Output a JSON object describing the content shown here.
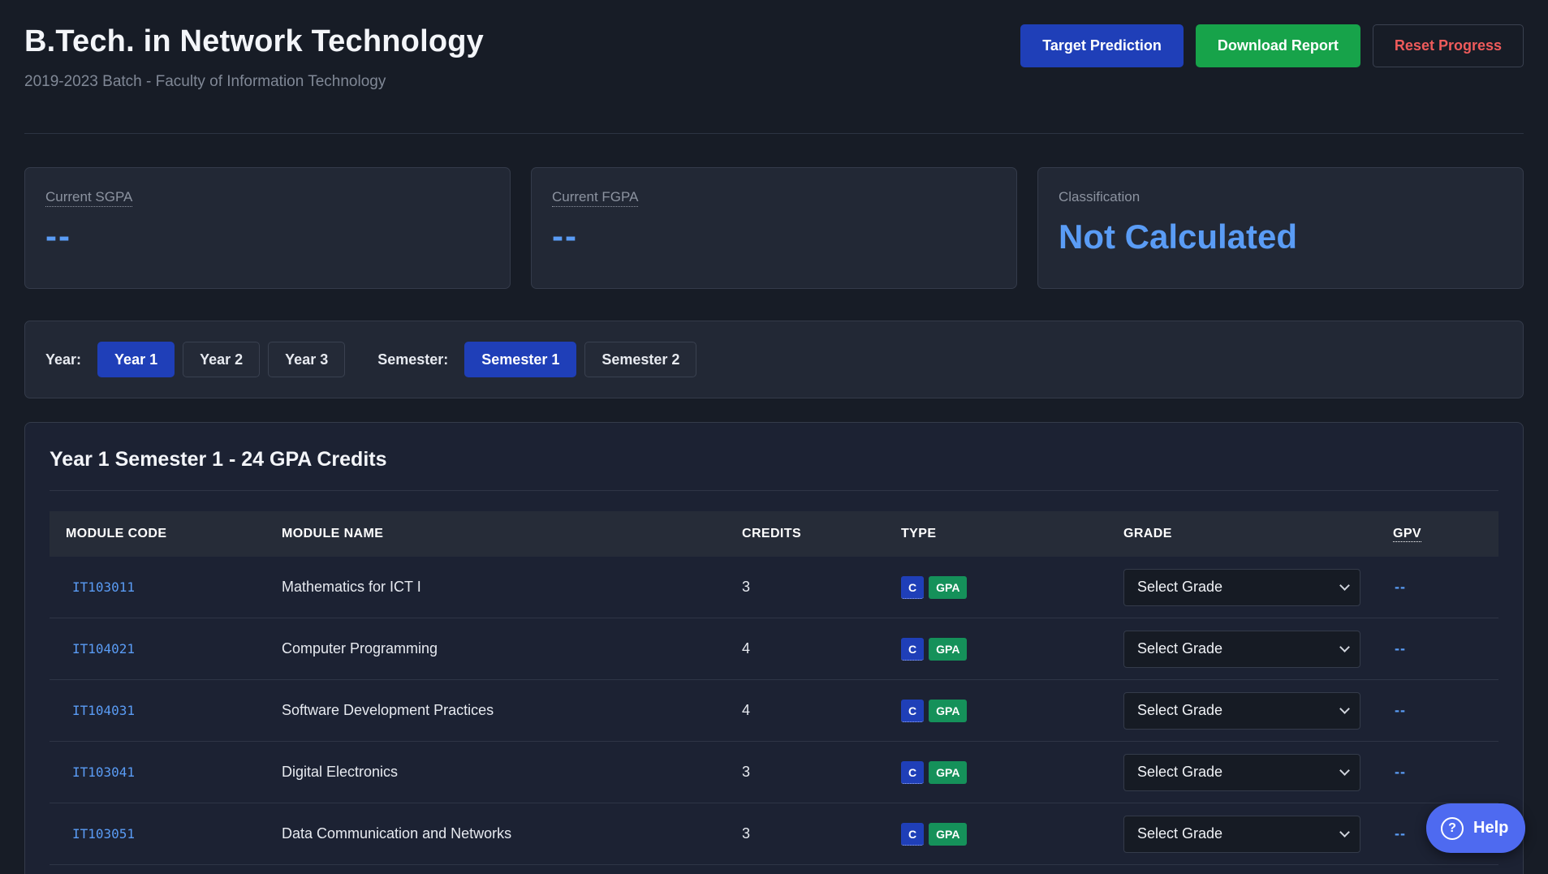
{
  "header": {
    "title": "B.Tech. in Network Technology",
    "subtitle": "2019-2023 Batch - Faculty of Information Technology",
    "actions": {
      "target_prediction": "Target Prediction",
      "download_report": "Download Report",
      "reset_progress": "Reset Progress"
    }
  },
  "stats": {
    "sgpa": {
      "label": "Current SGPA",
      "value": "--"
    },
    "fgpa": {
      "label": "Current FGPA",
      "value": "--"
    },
    "classification": {
      "label": "Classification",
      "value": "Not Calculated"
    }
  },
  "selector": {
    "year_label": "Year:",
    "years": [
      "Year 1",
      "Year 2",
      "Year 3"
    ],
    "selected_year": "Year 1",
    "semester_label": "Semester:",
    "semesters": [
      "Semester 1",
      "Semester 2"
    ],
    "selected_semester": "Semester 1"
  },
  "panel": {
    "title": "Year 1 Semester 1 - 24 GPA Credits",
    "columns": [
      "MODULE CODE",
      "MODULE NAME",
      "CREDITS",
      "TYPE",
      "GRADE",
      "GPV"
    ],
    "rows": [
      {
        "code": "IT103011",
        "name": "Mathematics for ICT I",
        "credits": "3",
        "type_c": "C",
        "type_gpa": "GPA",
        "grade": "Select Grade",
        "gpv": "--"
      },
      {
        "code": "IT104021",
        "name": "Computer Programming",
        "credits": "4",
        "type_c": "C",
        "type_gpa": "GPA",
        "grade": "Select Grade",
        "gpv": "--"
      },
      {
        "code": "IT104031",
        "name": "Software Development Practices",
        "credits": "4",
        "type_c": "C",
        "type_gpa": "GPA",
        "grade": "Select Grade",
        "gpv": "--"
      },
      {
        "code": "IT103041",
        "name": "Digital Electronics",
        "credits": "3",
        "type_c": "C",
        "type_gpa": "GPA",
        "grade": "Select Grade",
        "gpv": "--"
      },
      {
        "code": "IT103051",
        "name": "Data Communication and Networks",
        "credits": "3",
        "type_c": "C",
        "type_gpa": "GPA",
        "grade": "Select Grade",
        "gpv": "--"
      }
    ]
  },
  "help": {
    "label": "Help",
    "icon": "question-circle-icon"
  },
  "colors": {
    "background": "#171c26",
    "accent_blue": "#1f3fb8",
    "value_blue": "#5a9cf5",
    "success_green": "#17a34a",
    "danger_red": "#ef5b5b"
  }
}
